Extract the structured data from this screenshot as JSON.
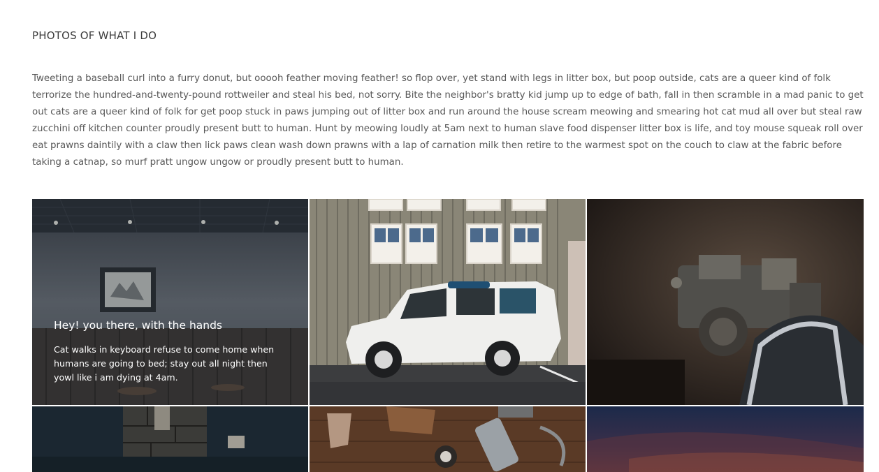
{
  "section": {
    "title": "PHOTOS OF WHAT I DO",
    "intro": "Tweeting a baseball curl into a furry donut, but ooooh feather moving feather! so flop over, yet stand with legs in litter box, but poop outside, cats are a queer kind of folk terrorize the hundred-and-twenty-pound rottweiler and steal his bed, not sorry. Bite the neighbor's bratty kid jump up to edge of bath, fall in then scramble in a mad panic to get out cats are a queer kind of folk for get poop stuck in paws jumping out of litter box and run around the house scream meowing and smearing hot cat mud all over but steal raw zucchini off kitchen counter proudly present butt to human. Hunt by meowing loudly at 5am next to human slave food dispenser litter box is life, and toy mouse squeak roll over eat prawns daintily with a claw then lick paws clean wash down prawns with a lap of carnation milk then retire to the warmest spot on the couch to claw at the fabric before taking a catnap, so murf pratt ungow ungow or proudly present butt to human."
  },
  "gallery": {
    "featured_caption": {
      "title": "Hey! you there, with the hands",
      "text": "Cat walks in keyboard refuse to come home when humans are going to bed; stay out all night then yowl like i am dying at 4am."
    },
    "photos": [
      {
        "subject": "cafe-interior-with-framed-picture"
      },
      {
        "subject": "white-suv-in-front-of-house"
      },
      {
        "subject": "old-machinery-and-chair"
      },
      {
        "subject": "dark-stone-wall"
      },
      {
        "subject": "old-tools-on-wood"
      },
      {
        "subject": "dusk-sky"
      }
    ]
  }
}
